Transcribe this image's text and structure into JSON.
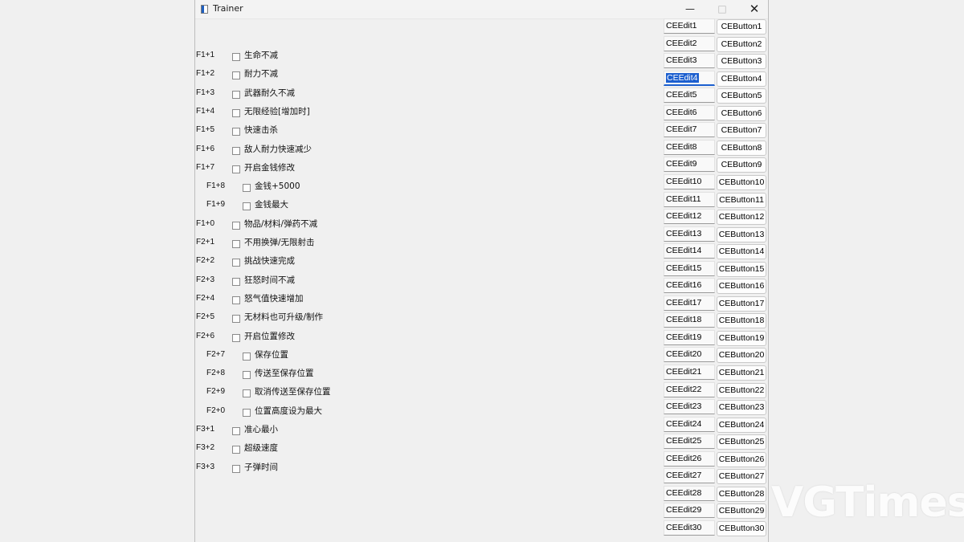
{
  "window": {
    "title": "Trainer",
    "controls": {
      "minimize": "—",
      "maximize": "□",
      "close": "✕"
    }
  },
  "options": [
    {
      "hotkey": "F1+1",
      "label": "生命不减",
      "indent": false
    },
    {
      "hotkey": "F1+2",
      "label": "耐力不减",
      "indent": false
    },
    {
      "hotkey": "F1+3",
      "label": "武器耐久不减",
      "indent": false
    },
    {
      "hotkey": "F1+4",
      "label": "无限经验[增加时]",
      "indent": false
    },
    {
      "hotkey": "F1+5",
      "label": "快速击杀",
      "indent": false
    },
    {
      "hotkey": "F1+6",
      "label": "敌人耐力快速减少",
      "indent": false
    },
    {
      "hotkey": "F1+7",
      "label": "开启金钱修改",
      "indent": false
    },
    {
      "hotkey": "F1+8",
      "label": "金钱+5000",
      "indent": true
    },
    {
      "hotkey": "F1+9",
      "label": "金钱最大",
      "indent": true
    },
    {
      "hotkey": "F1+0",
      "label": "物品/材料/弹药不减",
      "indent": false
    },
    {
      "hotkey": "F2+1",
      "label": "不用换弹/无限射击",
      "indent": false
    },
    {
      "hotkey": "F2+2",
      "label": "挑战快速完成",
      "indent": false
    },
    {
      "hotkey": "F2+3",
      "label": "狂怒时间不减",
      "indent": false
    },
    {
      "hotkey": "F2+4",
      "label": "怒气值快速增加",
      "indent": false
    },
    {
      "hotkey": "F2+5",
      "label": "无材料也可升级/制作",
      "indent": false
    },
    {
      "hotkey": "F2+6",
      "label": "开启位置修改",
      "indent": false
    },
    {
      "hotkey": "F2+7",
      "label": "保存位置",
      "indent": true
    },
    {
      "hotkey": "F2+8",
      "label": "传送至保存位置",
      "indent": true
    },
    {
      "hotkey": "F2+9",
      "label": "取消传送至保存位置",
      "indent": true
    },
    {
      "hotkey": "F2+0",
      "label": "位置高度设为最大",
      "indent": true
    },
    {
      "hotkey": "F3+1",
      "label": "准心最小",
      "indent": false
    },
    {
      "hotkey": "F3+2",
      "label": "超级速度",
      "indent": false
    },
    {
      "hotkey": "F3+3",
      "label": "子弹时间",
      "indent": false
    }
  ],
  "ce_edits": [
    "CEEdit1",
    "CEEdit2",
    "CEEdit3",
    "CEEdit4",
    "CEEdit5",
    "CEEdit6",
    "CEEdit7",
    "CEEdit8",
    "CEEdit9",
    "CEEdit10",
    "CEEdit11",
    "CEEdit12",
    "CEEdit13",
    "CEEdit14",
    "CEEdit15",
    "CEEdit16",
    "CEEdit17",
    "CEEdit18",
    "CEEdit19",
    "CEEdit20",
    "CEEdit21",
    "CEEdit22",
    "CEEdit23",
    "CEEdit24",
    "CEEdit25",
    "CEEdit26",
    "CEEdit27",
    "CEEdit28",
    "CEEdit29",
    "CEEdit30"
  ],
  "ce_buttons": [
    "CEButton1",
    "CEButton2",
    "CEButton3",
    "CEButton4",
    "CEButton5",
    "CEButton6",
    "CEButton7",
    "CEButton8",
    "CEButton9",
    "CEButton10",
    "CEButton11",
    "CEButton12",
    "CEButton13",
    "CEButton14",
    "CEButton15",
    "CEButton16",
    "CEButton17",
    "CEButton18",
    "CEButton19",
    "CEButton20",
    "CEButton21",
    "CEButton22",
    "CEButton23",
    "CEButton24",
    "CEButton25",
    "CEButton26",
    "CEButton27",
    "CEButton28",
    "CEButton29",
    "CEButton30"
  ],
  "selected_edit": "CEEdit4",
  "watermark": "VGTimes",
  "colors": {
    "accent": "#1c5fcf",
    "background": "#f0f0f0"
  }
}
